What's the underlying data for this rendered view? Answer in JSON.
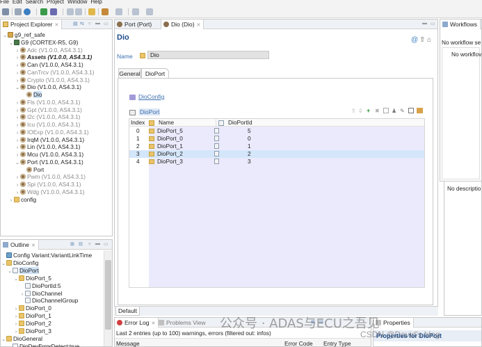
{
  "menu": [
    "File",
    "Edit",
    "Search",
    "Project",
    "Window",
    "Help"
  ],
  "project_explorer": {
    "tab_label": "Project Explorer",
    "items": [
      {
        "label": "g9_ref_safe",
        "level": 0,
        "icon": "project-icon",
        "expanded": true
      },
      {
        "label": "G9 (CORTEX-R5, G9)",
        "level": 1,
        "icon": "chip-icon",
        "expanded": true
      },
      {
        "label": "Adc (V1.0.0, AS4.3.1)",
        "level": 2,
        "icon": "module-icon",
        "style": "gray"
      },
      {
        "label": "Assets (V1.0.0, AS4.3.1)",
        "level": 2,
        "icon": "module-icon",
        "style": "bold-italic"
      },
      {
        "label": "Can (V1.0.0, AS4.3.1)",
        "level": 2,
        "icon": "module-icon",
        "style": "normal"
      },
      {
        "label": "CanTrcv (V1.0.0, AS4.3.1)",
        "level": 2,
        "icon": "module-icon",
        "style": "gray"
      },
      {
        "label": "Crypto (V1.0.0, AS4.3.1)",
        "level": 2,
        "icon": "module-icon",
        "style": "gray"
      },
      {
        "label": "Dio (V1.0.0, AS4.3.1)",
        "level": 2,
        "icon": "module-icon",
        "style": "normal",
        "expanded": true
      },
      {
        "label": "Dio",
        "level": 3,
        "icon": "module-icon",
        "style": "normal",
        "selected": true
      },
      {
        "label": "Fls (V1.0.0, AS4.3.1)",
        "level": 2,
        "icon": "module-icon",
        "style": "gray"
      },
      {
        "label": "Gpt (V1.0.0, AS4.3.1)",
        "level": 2,
        "icon": "module-icon",
        "style": "gray"
      },
      {
        "label": "I2c (V1.0.0, AS4.3.1)",
        "level": 2,
        "icon": "module-icon",
        "style": "gray"
      },
      {
        "label": "Icu (V1.0.0, AS4.3.1)",
        "level": 2,
        "icon": "module-icon",
        "style": "gray"
      },
      {
        "label": "IOExp (V1.0.0, AS4.3.1)",
        "level": 2,
        "icon": "module-icon",
        "style": "gray"
      },
      {
        "label": "IrqM (V1.0.0, AS4.3.1)",
        "level": 2,
        "icon": "module-icon",
        "style": "normal"
      },
      {
        "label": "Lin (V1.0.0, AS4.3.1)",
        "level": 2,
        "icon": "module-icon",
        "style": "normal"
      },
      {
        "label": "Mcu (V1.0.0, AS4.3.1)",
        "level": 2,
        "icon": "module-icon",
        "style": "normal"
      },
      {
        "label": "Port (V1.0.0, AS4.3.1)",
        "level": 2,
        "icon": "module-icon",
        "style": "normal",
        "expanded": true
      },
      {
        "label": "Port",
        "level": 3,
        "icon": "module-icon",
        "style": "normal"
      },
      {
        "label": "Pwm (V1.0.0, AS4.3.1)",
        "level": 2,
        "icon": "module-icon",
        "style": "gray"
      },
      {
        "label": "Spi (V1.0.0, AS4.3.1)",
        "level": 2,
        "icon": "module-icon",
        "style": "gray"
      },
      {
        "label": "Wdg (V1.0.0, AS4.3.1)",
        "level": 2,
        "icon": "module-icon",
        "style": "gray"
      },
      {
        "label": "config",
        "level": 1,
        "icon": "folder-icon",
        "style": "normal"
      }
    ]
  },
  "outline": {
    "tab_label": "Outline",
    "items": [
      {
        "label": "Config Variant:VariantLinkTime",
        "level": 0,
        "icon": "config-icon",
        "twisty": ""
      },
      {
        "label": "DioConfig",
        "level": 0,
        "icon": "folder-icon",
        "twisty": "v"
      },
      {
        "label": "DioPort",
        "level": 1,
        "icon": "doc-icon",
        "twisty": "v",
        "selected": true
      },
      {
        "label": "DioPort_5",
        "level": 2,
        "icon": "folder-icon",
        "twisty": "v"
      },
      {
        "label": "DioPortId:5",
        "level": 3,
        "icon": "doc-icon",
        "twisty": ""
      },
      {
        "label": "DioChannel",
        "level": 3,
        "icon": "doc-icon",
        "twisty": ">"
      },
      {
        "label": "DioChannelGroup",
        "level": 3,
        "icon": "doc-icon",
        "twisty": ""
      },
      {
        "label": "DioPort_0",
        "level": 2,
        "icon": "folder-icon",
        "twisty": ">"
      },
      {
        "label": "DioPort_1",
        "level": 2,
        "icon": "folder-icon",
        "twisty": ">"
      },
      {
        "label": "DioPort_2",
        "level": 2,
        "icon": "folder-icon",
        "twisty": ">"
      },
      {
        "label": "DioPort_3",
        "level": 2,
        "icon": "folder-icon",
        "twisty": ">"
      },
      {
        "label": "DioGeneral",
        "level": 0,
        "icon": "folder-icon",
        "twisty": "v"
      },
      {
        "label": "DioDevErrorDetect:true",
        "level": 1,
        "icon": "doc-icon",
        "twisty": ""
      }
    ]
  },
  "editor": {
    "tabs": [
      {
        "label": "Port (Port)",
        "active": false
      },
      {
        "label": "Dio (Dio)",
        "active": true
      }
    ],
    "title": "Dio",
    "name_label": "Name",
    "name_value": "Dio",
    "subtabs": [
      "General",
      "DioPort"
    ],
    "active_subtab": "DioPort",
    "config_link": "DioConfig",
    "table_title": "DioPort",
    "columns": [
      "Index",
      "Name",
      "DioPortId"
    ],
    "rows": [
      {
        "index": "0",
        "name": "DioPort_5",
        "id": "5"
      },
      {
        "index": "1",
        "name": "DioPort_0",
        "id": "0"
      },
      {
        "index": "2",
        "name": "DioPort_1",
        "id": "1"
      },
      {
        "index": "3",
        "name": "DioPort_2",
        "id": "2",
        "selected": true
      },
      {
        "index": "4",
        "name": "DioPort_3",
        "id": "3"
      }
    ],
    "bottom_tab": "Default"
  },
  "workflows": {
    "tab_label": "Workflows",
    "header_text": "No workflow se",
    "body_text": "No workflov",
    "description_text": "No descriptio"
  },
  "bottom": {
    "error_log_tab": "Error Log",
    "problems_tab": "Problems View",
    "status_text": "Last 2 entries (up to 100) warnings, errors (filtered out: infos)",
    "columns": [
      "Message",
      "Error Code",
      "Entry Type"
    ],
    "properties_tab": "Properties",
    "properties_title": "Properties for DioPort"
  },
  "watermark": {
    "line1": "公众号 · ADAS与ECU之吾见",
    "line2": "CSDN @David's blog"
  },
  "colors": {
    "accent": "#1f4e8c",
    "selection": "#cfe3f7",
    "table_fill": "#ebeafc",
    "table_selected": "#d4e6fa"
  }
}
